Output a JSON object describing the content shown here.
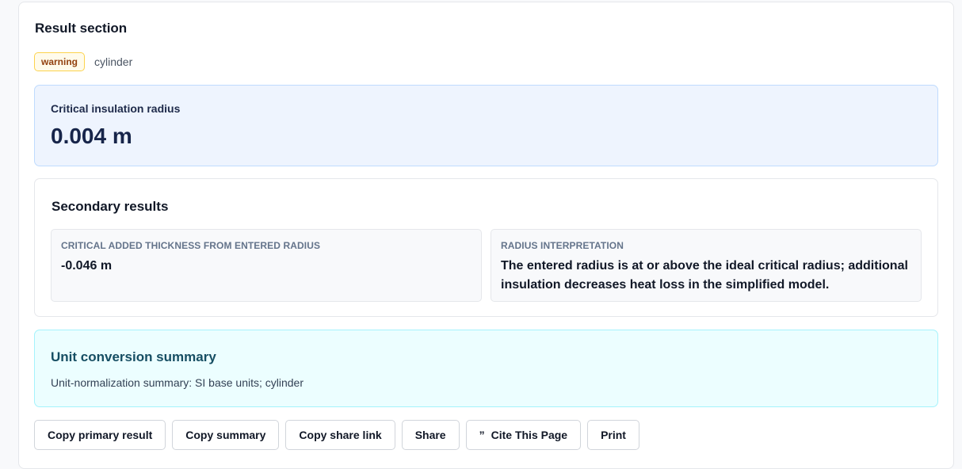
{
  "result": {
    "title": "Result section",
    "badge": "warning",
    "geometry": "cylinder",
    "primary_label": "Critical insulation radius",
    "primary_value": "0.004 m"
  },
  "secondary": {
    "title": "Secondary results",
    "items": [
      {
        "label": "CRITICAL ADDED THICKNESS FROM ENTERED RADIUS",
        "value": "-0.046 m"
      },
      {
        "label": "RADIUS INTERPRETATION",
        "value": "The entered radius is at or above the ideal critical radius; additional insulation decreases heat loss in the simplified model."
      }
    ]
  },
  "units": {
    "title": "Unit conversion summary",
    "text": "Unit-normalization summary: SI base units; cylinder"
  },
  "actions": {
    "copy_primary": "Copy primary result",
    "copy_summary": "Copy summary",
    "copy_link": "Copy share link",
    "share": "Share",
    "cite": "Cite This Page",
    "cite_icon": "quote-icon",
    "print": "Print"
  },
  "colors": {
    "warning_bg": "#fffbeb",
    "warning_border": "#fcd34d",
    "primary_bg": "#eef4fe",
    "units_bg": "#ecfeff"
  }
}
